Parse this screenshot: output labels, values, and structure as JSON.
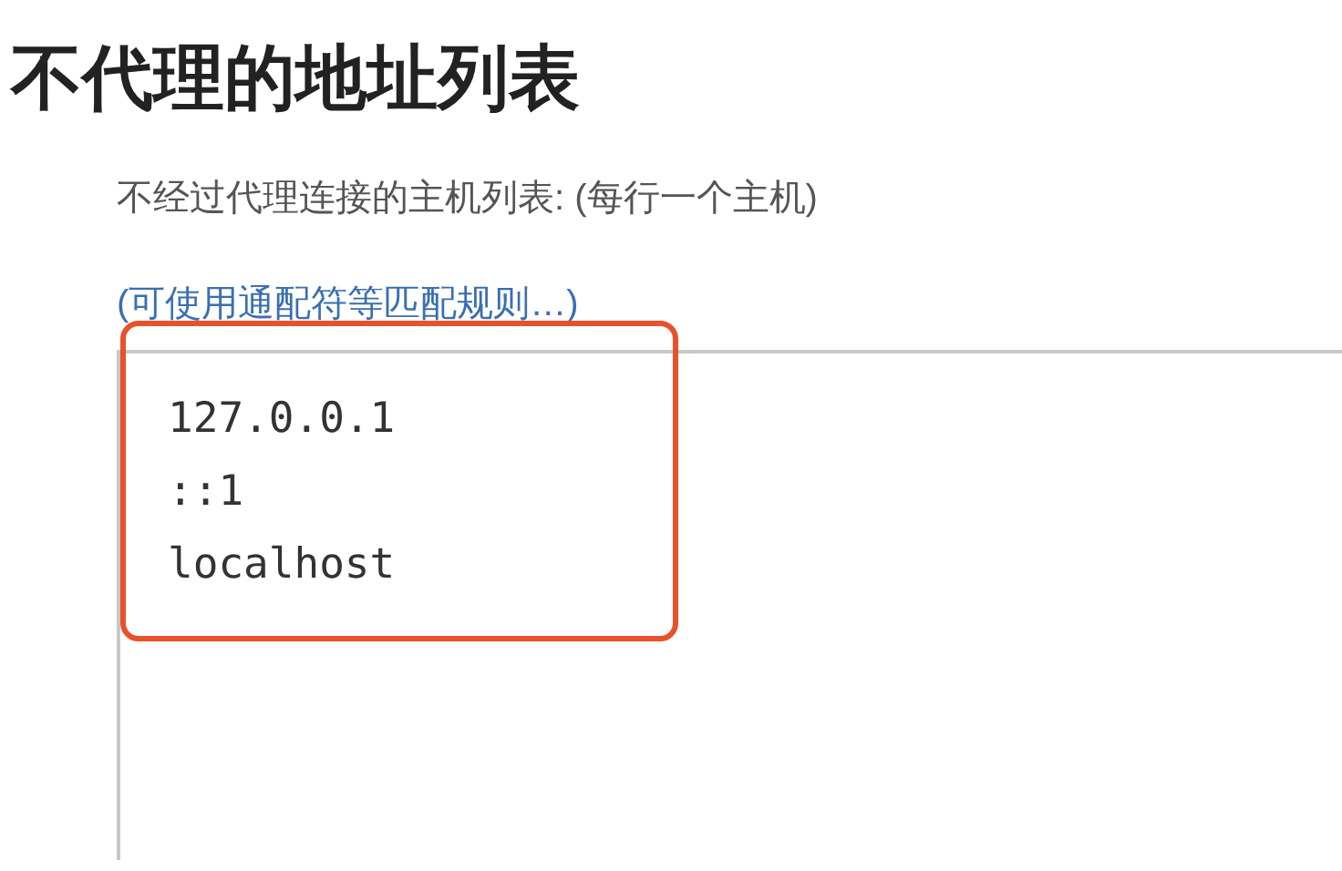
{
  "heading": "不代理的地址列表",
  "description": "不经过代理连接的主机列表: (每行一个主机)",
  "link": "(可使用通配符等匹配规则…)",
  "host_list": {
    "lines": [
      "127.0.0.1",
      "::1",
      "localhost"
    ],
    "highlighted": true
  }
}
